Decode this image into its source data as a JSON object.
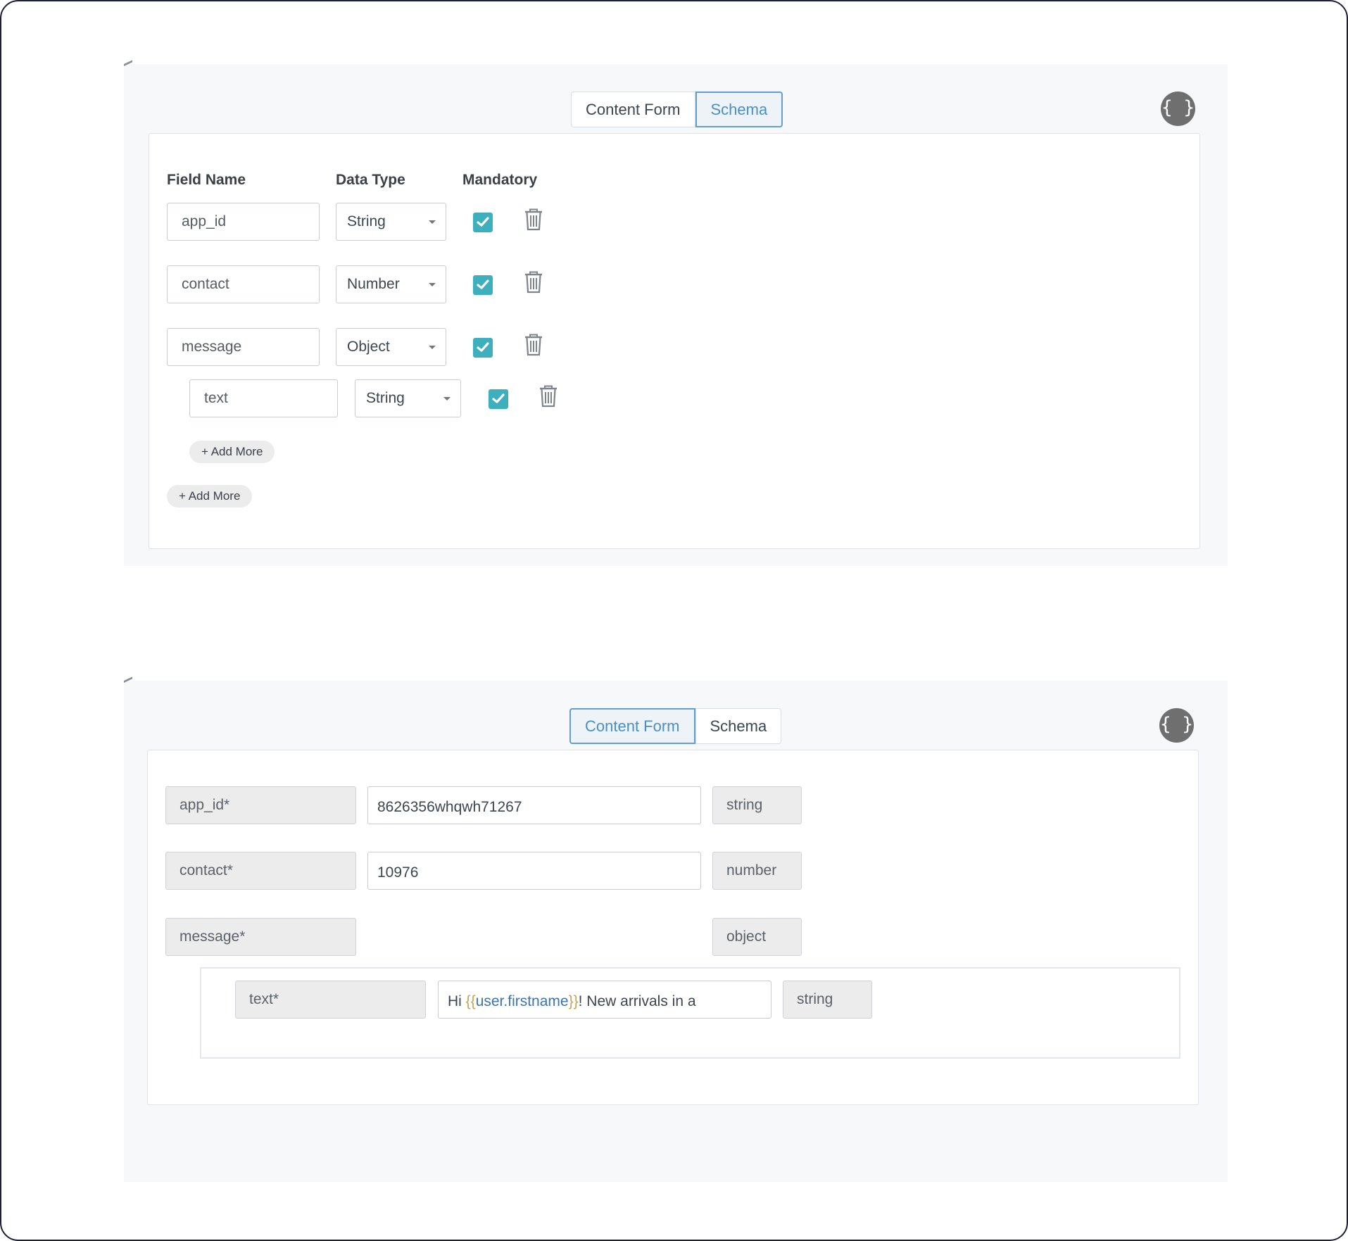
{
  "schema_view": {
    "tabs": [
      {
        "label": "Content Form",
        "active": false
      },
      {
        "label": "Schema",
        "active": true
      }
    ],
    "json_toggle_icon": "curly-braces-icon",
    "json_toggle_text": "{ }",
    "headers": {
      "field_name": "Field Name",
      "data_type": "Data Type",
      "mandatory": "Mandatory"
    },
    "rows": [
      {
        "field": "app_id",
        "type": "String",
        "mandatory": true
      },
      {
        "field": "contact",
        "type": "Number",
        "mandatory": true
      },
      {
        "field": "message",
        "type": "Object",
        "mandatory": true
      }
    ],
    "nested_rows": [
      {
        "field": "text",
        "type": "String",
        "mandatory": true
      }
    ],
    "nested_add_more": "+ Add More",
    "add_more": "+ Add More"
  },
  "content_form_view": {
    "tabs": [
      {
        "label": "Content Form",
        "active": true
      },
      {
        "label": "Schema",
        "active": false
      }
    ],
    "json_toggle_icon": "curly-braces-icon",
    "json_toggle_text": "{ }",
    "fields": [
      {
        "label": "app_id*",
        "value": "8626356whqwh71267",
        "type": "string"
      },
      {
        "label": "contact*",
        "value": "10976",
        "type": "number"
      },
      {
        "label": "message*",
        "value": "",
        "type": "object"
      }
    ],
    "nested_fields": [
      {
        "label": "text*",
        "value_prefix": "Hi ",
        "value_brace_open": "{{",
        "value_var": "user.firstname",
        "value_brace_close": "}}",
        "value_suffix": "! New arrivals in a",
        "type": "string"
      }
    ]
  },
  "colors": {
    "accent_blue": "#4a8fc7",
    "checkbox_teal": "#3dafbd",
    "json_button_gray": "#6f6f6f"
  }
}
